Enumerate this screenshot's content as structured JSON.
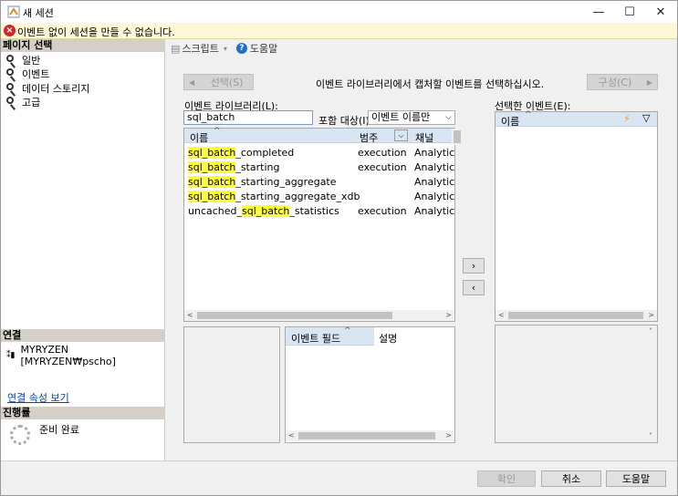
{
  "window": {
    "title": "새 세션",
    "minimize": "—",
    "maximize": "☐",
    "close": "✕"
  },
  "error": {
    "message": "이벤트 없이 세션을 만들 수 없습니다."
  },
  "left": {
    "page_select_header": "페이지 선택",
    "pages": [
      "일반",
      "이벤트",
      "데이터 스토리지",
      "고급"
    ],
    "connection_header": "연결",
    "connection_server": "MYRYZEN [MYRYZEN₩pscho]",
    "connection_link": "연결 속성 보기",
    "progress_header": "진행률",
    "progress_status": "준비 완료"
  },
  "toolbar": {
    "script": "스크립트",
    "help": "도움말"
  },
  "events": {
    "select_button": "선택(S)",
    "instruction": "이벤트 라이브러리에서 캡처할 이벤트를 선택하십시오.",
    "configure_button": "구성(C)",
    "library_label": "이벤트 라이브러리(L):",
    "search_value": "sql_batch",
    "include_label": "포함 대상(I)",
    "include_value": "이벤트 이름만",
    "columns": {
      "name": "이름",
      "category": "범주",
      "channel": "채널"
    },
    "rows": [
      {
        "prefix": "",
        "match": "sql_batch",
        "suffix": "_completed",
        "category": "execution",
        "channel": "Analytic"
      },
      {
        "prefix": "",
        "match": "sql_batch",
        "suffix": "_starting",
        "category": "execution",
        "channel": "Analytic"
      },
      {
        "prefix": "",
        "match": "sql_batch",
        "suffix": "_starting_aggregate",
        "category": "",
        "channel": "Analytic"
      },
      {
        "prefix": "",
        "match": "sql_batch",
        "suffix": "_starting_aggregate_xdb",
        "category": "",
        "channel": "Analytic"
      },
      {
        "prefix": "uncached_",
        "match": "sql_batch",
        "suffix": "_statistics",
        "category": "execution",
        "channel": "Analytic"
      }
    ],
    "fields_columns": {
      "field": "이벤트 필드",
      "description": "설명"
    },
    "selected_label": "선택한 이벤트(E):",
    "selected_column": "이름",
    "add_arrow": "›",
    "remove_arrow": "‹"
  },
  "footer": {
    "ok": "확인",
    "cancel": "취소",
    "help": "도움말"
  },
  "colors": {
    "highlight": "#ffff3a",
    "header_blue": "#d9e5f3",
    "error_red": "#d5232b"
  }
}
